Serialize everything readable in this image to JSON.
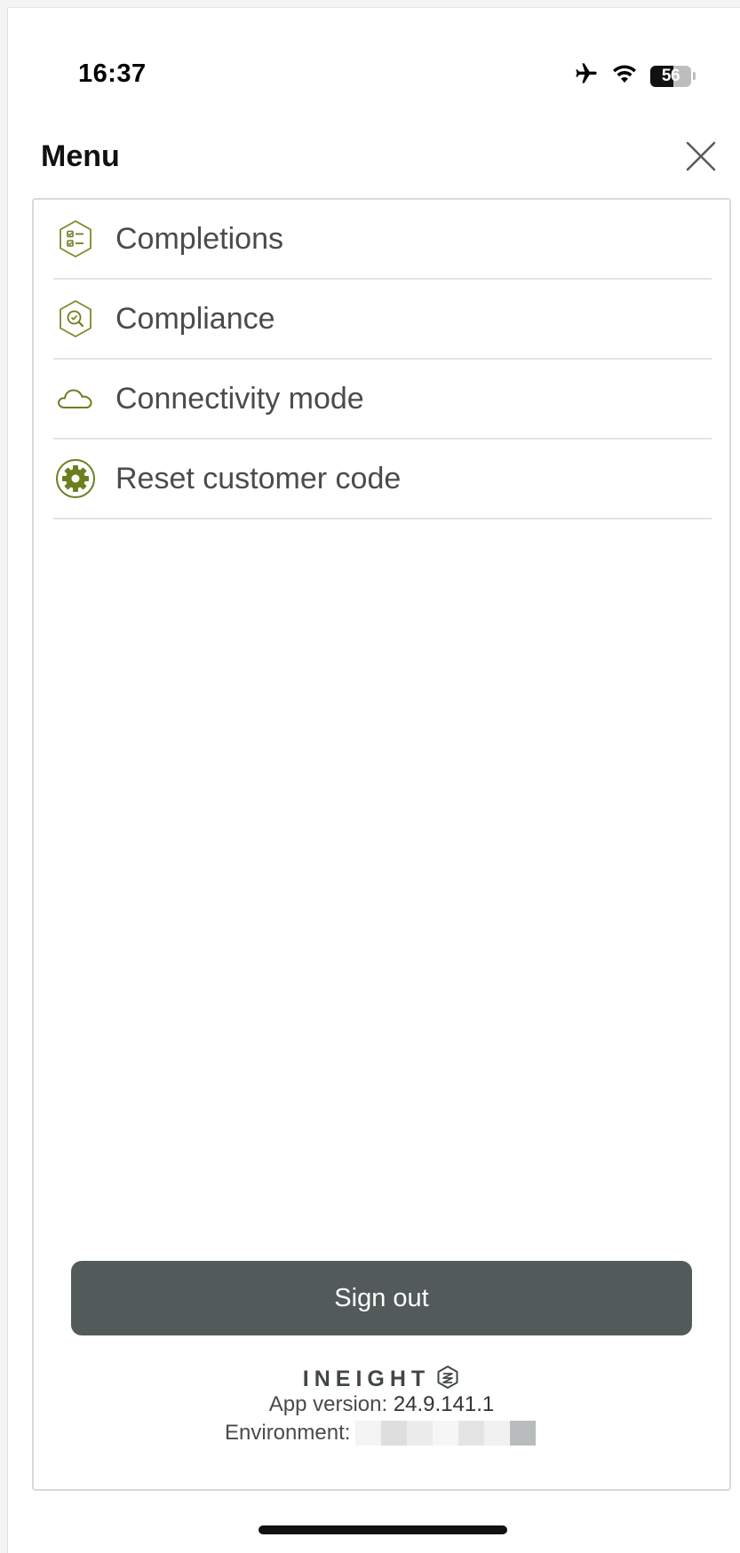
{
  "status_bar": {
    "time": "16:37",
    "battery": "56",
    "battery_level": 0.56
  },
  "header": {
    "title": "Menu"
  },
  "menu": {
    "items": [
      {
        "label": "Completions",
        "icon": "completions-hexagon-icon"
      },
      {
        "label": "Compliance",
        "icon": "compliance-hexagon-icon"
      },
      {
        "label": "Connectivity mode",
        "icon": "cloud-icon"
      },
      {
        "label": "Reset customer code",
        "icon": "gear-icon"
      }
    ]
  },
  "footer": {
    "sign_out": "Sign out",
    "brand": "INEIGHT",
    "version_label": "App version:",
    "version": "24.9.141.1",
    "environment_label": "Environment:"
  },
  "colors": {
    "accent_green": "#6b7f1f",
    "button": "#525b5a",
    "label_text": "#4b4b4b",
    "divider": "#e3e3e3"
  }
}
